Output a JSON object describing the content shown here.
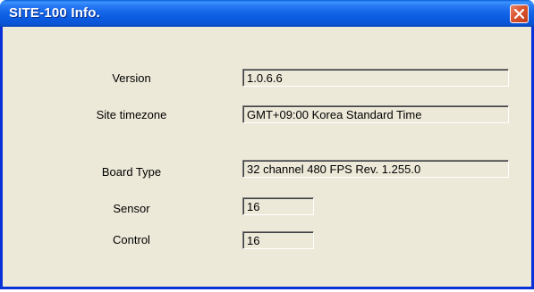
{
  "window": {
    "title": "SITE-100 Info.",
    "close_icon": "close-icon"
  },
  "fields": {
    "version": {
      "label": "Version",
      "value": "1.0.6.6"
    },
    "timezone": {
      "label": "Site timezone",
      "value": "GMT+09:00 Korea Standard Time"
    },
    "board_type": {
      "label": "Board Type",
      "value": "32 channel 480 FPS Rev. 1.255.0"
    },
    "sensor": {
      "label": "Sensor",
      "value": "16"
    },
    "control": {
      "label": "Control",
      "value": "16"
    }
  },
  "colors": {
    "titlebar": "#0a5fd8",
    "frame": "#0831d9",
    "body": "#ece9d8",
    "close_button": "#d9532f"
  }
}
